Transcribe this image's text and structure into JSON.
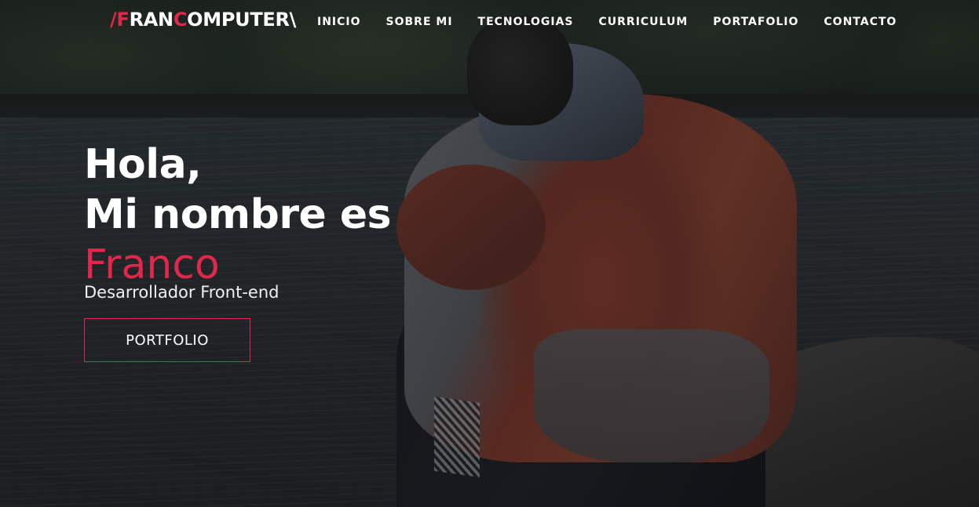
{
  "brand": {
    "slash_open": "/",
    "f": "F",
    "ran": "RAN",
    "c": "C",
    "omputer": "OMPUTER",
    "slash_close": "\\"
  },
  "nav": {
    "items": [
      {
        "label": "INICIO"
      },
      {
        "label": "SOBRE MI"
      },
      {
        "label": "TECNOLOGIAS"
      },
      {
        "label": "CURRICULUM"
      },
      {
        "label": "PORTAFOLIO"
      },
      {
        "label": "CONTACTO"
      }
    ]
  },
  "hero": {
    "greeting": "Hola,",
    "intro": "Mi nombre es",
    "name": "Franco",
    "role": "Desarrollador Front-end",
    "cta_label": "PORTFOLIO"
  },
  "colors": {
    "accent": "#e0284c",
    "text": "#ffffff"
  }
}
